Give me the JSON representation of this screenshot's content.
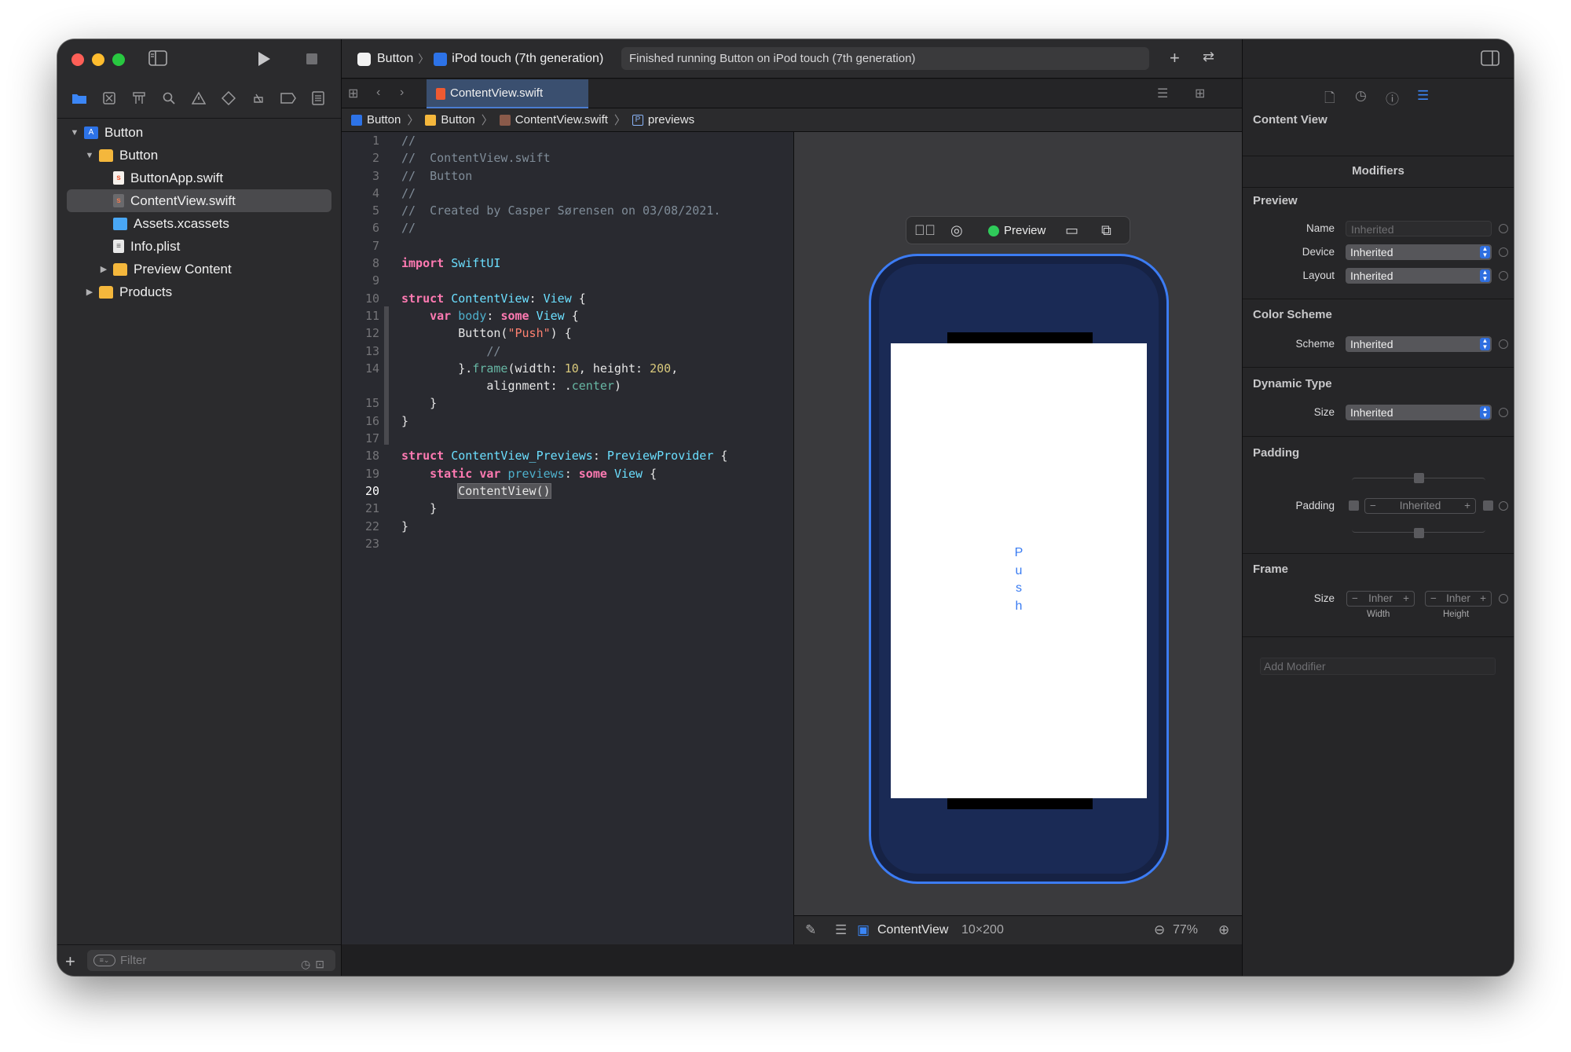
{
  "navigator": {
    "filter_placeholder": "Filter",
    "items": [
      {
        "label": "Button",
        "level": 0
      },
      {
        "label": "Button",
        "level": 1
      },
      {
        "label": "ButtonApp.swift",
        "level": 2
      },
      {
        "label": "ContentView.swift",
        "level": 2,
        "selected": true
      },
      {
        "label": "Assets.xcassets",
        "level": 2
      },
      {
        "label": "Info.plist",
        "level": 2
      },
      {
        "label": "Preview Content",
        "level": 2
      },
      {
        "label": "Products",
        "level": 1
      }
    ]
  },
  "toolbar": {
    "scheme": "Button",
    "destination": "iPod touch (7th generation)",
    "activity": "Finished running Button on iPod touch (7th generation)"
  },
  "tab": {
    "label": "ContentView.swift"
  },
  "jumpbar": [
    "Button",
    "Button",
    "ContentView.swift",
    "previews"
  ],
  "editor": {
    "current_line": 20,
    "line_numbers": [
      "1",
      "2",
      "3",
      "4",
      "5",
      "6",
      "7",
      "8",
      "9",
      "10",
      "11",
      "12",
      "13",
      "14",
      "",
      "15",
      "16",
      "17",
      "18",
      "19",
      "20",
      "21",
      "22",
      "23"
    ],
    "code": [
      "//",
      "//  ContentView.swift",
      "//  Button",
      "//",
      "//  Created by Casper Sørensen on 03/08/2021.",
      "//",
      "",
      "import SwiftUI",
      "",
      "struct ContentView: View {",
      "    var body: some View {",
      "        Button(\"Push\") {",
      "            //",
      "        }.frame(width: 10, height: 200,",
      "            alignment: .center)",
      "    }",
      "}",
      "",
      "struct ContentView_Previews: PreviewProvider {",
      "    static var previews: some View {",
      "        ContentView()",
      "    }",
      "}",
      ""
    ]
  },
  "preview": {
    "label": "Preview",
    "button_text": [
      "P",
      "u",
      "s",
      "h"
    ],
    "status_color": "#2fcb5a",
    "device_color": "#1a2a55",
    "accent": "#3c7cf4"
  },
  "canvas_footer": {
    "view_name": "ContentView",
    "size": "10×200",
    "zoom": "77%"
  },
  "inspector": {
    "title": "Content View",
    "modifiers_heading": "Modifiers",
    "preview": {
      "heading": "Preview",
      "name_label": "Name",
      "name_placeholder": "Inherited",
      "device_label": "Device",
      "device_value": "Inherited",
      "layout_label": "Layout",
      "layout_value": "Inherited"
    },
    "color_scheme": {
      "heading": "Color Scheme",
      "scheme_label": "Scheme",
      "scheme_value": "Inherited"
    },
    "dynamic_type": {
      "heading": "Dynamic Type",
      "size_label": "Size",
      "size_value": "Inherited"
    },
    "padding": {
      "heading": "Padding",
      "label": "Padding",
      "value": "Inherited",
      "minus": "−",
      "plus": "+"
    },
    "frame": {
      "heading": "Frame",
      "size_label": "Size",
      "width_value": "Inher",
      "height_value": "Inher",
      "width_caption": "Width",
      "height_caption": "Height"
    },
    "add_modifier_placeholder": "Add Modifier"
  }
}
